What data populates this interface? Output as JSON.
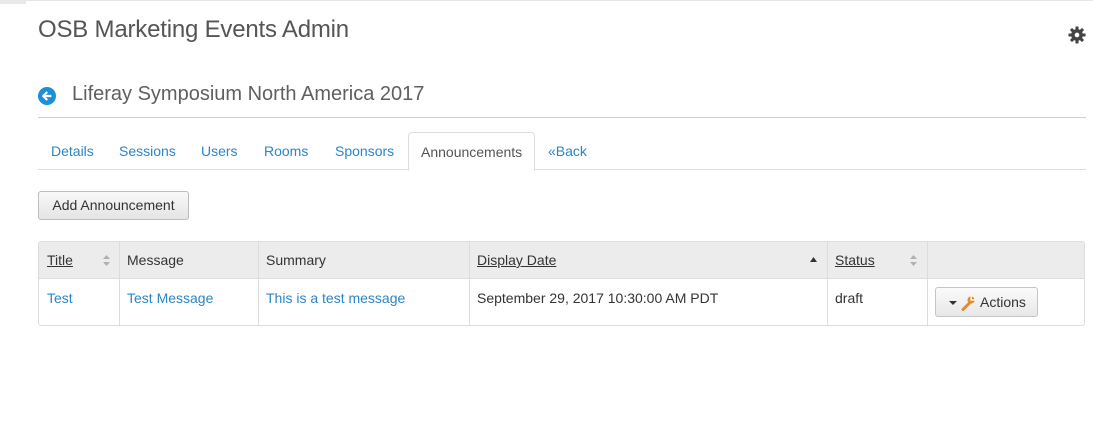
{
  "app": {
    "title": "OSB Marketing Events Admin"
  },
  "page": {
    "title": "Liferay Symposium North America 2017"
  },
  "tabs": [
    {
      "label": "Details"
    },
    {
      "label": "Sessions"
    },
    {
      "label": "Users"
    },
    {
      "label": "Rooms"
    },
    {
      "label": "Sponsors"
    },
    {
      "label": "Announcements",
      "active": true
    },
    {
      "label": "«Back"
    }
  ],
  "toolbar": {
    "add_label": "Add Announcement"
  },
  "table": {
    "columns": [
      {
        "label": "Title",
        "sortable": true
      },
      {
        "label": "Message",
        "sortable": false
      },
      {
        "label": "Summary",
        "sortable": false
      },
      {
        "label": "Display Date",
        "sortable": true,
        "sorted": "ascending"
      },
      {
        "label": "Status",
        "sortable": true
      },
      {
        "label": "",
        "sortable": false
      }
    ],
    "rows": [
      {
        "title": "Test",
        "message": "Test Message",
        "summary": "This is a test message",
        "display_date": "September 29, 2017 10:30:00 AM PDT",
        "status": "draft",
        "actions_label": "Actions"
      }
    ]
  },
  "icons": {
    "settings": "gear-icon",
    "back": "back-arrow-icon",
    "actions": "wrench-icon"
  },
  "colors": {
    "link": "#2a86c9",
    "back_circle": "#1d8fd8",
    "wrench": "#e38a2a"
  }
}
